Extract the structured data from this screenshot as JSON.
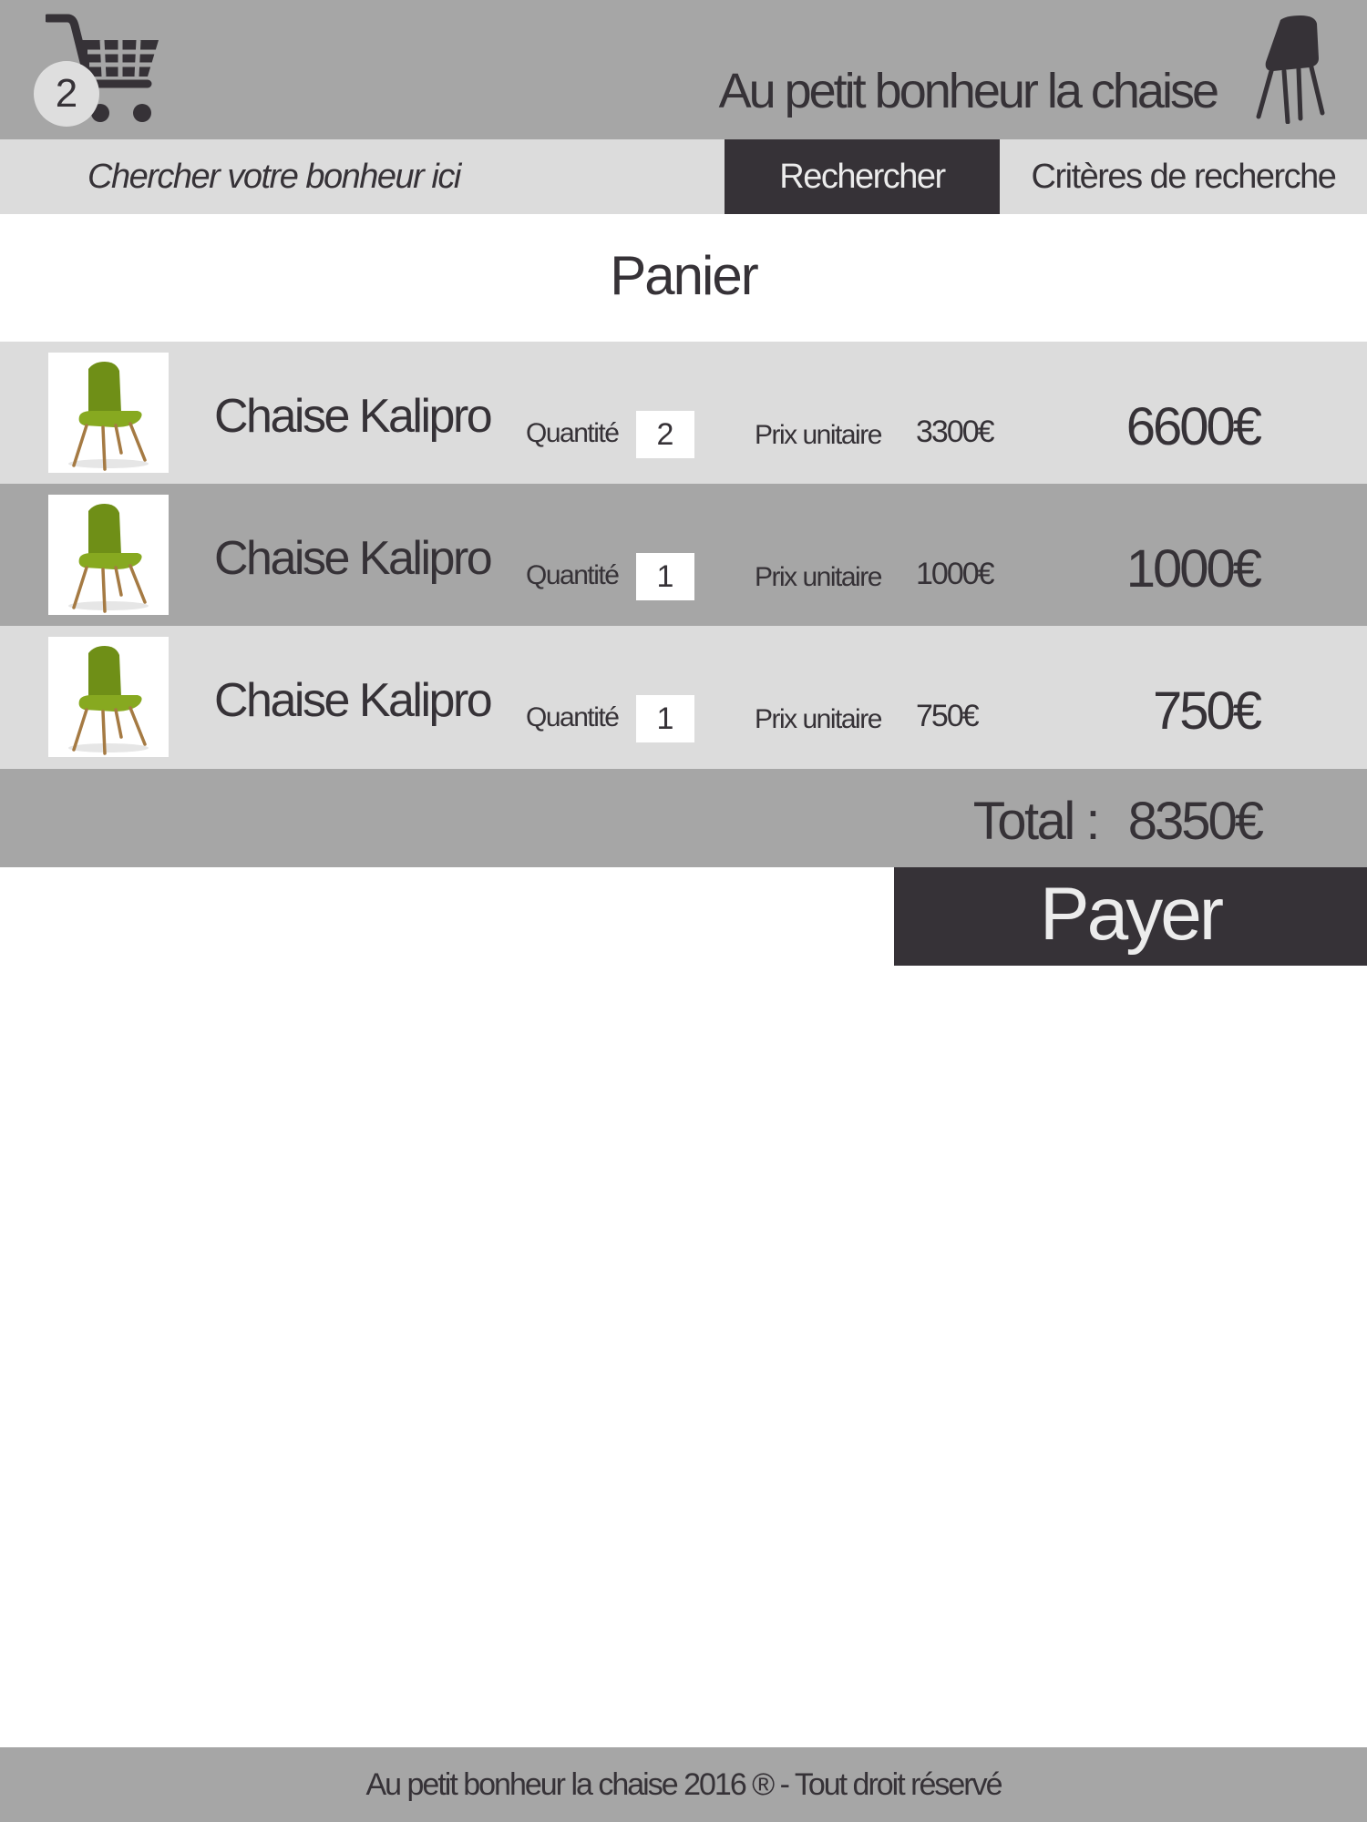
{
  "header": {
    "site_title": "Au petit bonheur la chaise",
    "cart_count": "2",
    "cart_icon": "shopping-cart-icon",
    "logo_icon": "chair-icon"
  },
  "search": {
    "placeholder": "Chercher votre bonheur ici",
    "button_label": "Rechercher",
    "criteria_label": "Critères de recherche"
  },
  "page": {
    "title": "Panier"
  },
  "cart": {
    "items": [
      {
        "name": "Chaise Kalipro",
        "quantity_label": "Quantité",
        "quantity": "2",
        "unit_price_label": "Prix unitaire",
        "unit_price": "3300€",
        "line_total": "6600€"
      },
      {
        "name": "Chaise Kalipro",
        "quantity_label": "Quantité",
        "quantity": "1",
        "unit_price_label": "Prix unitaire",
        "unit_price": "1000€",
        "line_total": "1000€"
      },
      {
        "name": "Chaise Kalipro",
        "quantity_label": "Quantité",
        "quantity": "1",
        "unit_price_label": "Prix unitaire",
        "unit_price": "750€",
        "line_total": "750€"
      }
    ],
    "total_label": "Total :",
    "total_value": "8350€",
    "pay_label": "Payer"
  },
  "footer": {
    "text": "Au petit bonheur la chaise 2016 ® - Tout droit réservé"
  },
  "colors": {
    "dark": "#363237",
    "mid_gray": "#a6a6a6",
    "light_gray": "#dcdcdc",
    "chair_green": "#7a9a1c"
  }
}
